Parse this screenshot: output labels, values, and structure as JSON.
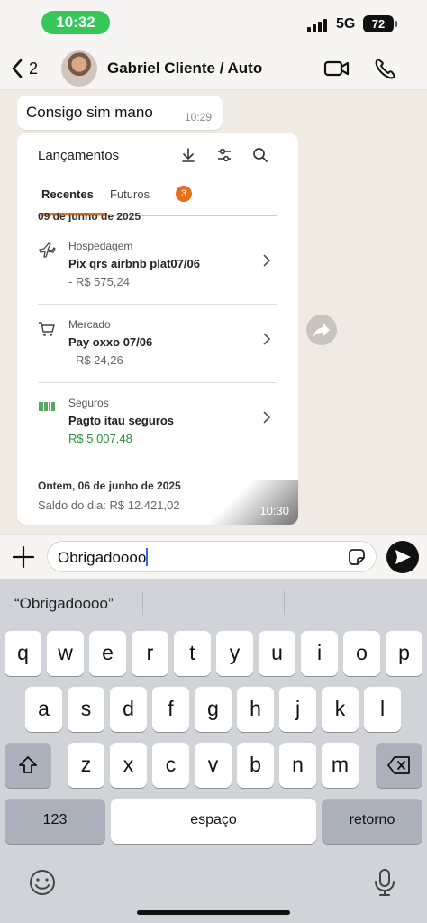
{
  "status_bar": {
    "time": "10:32",
    "network": "5G",
    "battery": "72"
  },
  "header": {
    "back_count": "2",
    "contact_name": "Gabriel Cliente / Auto"
  },
  "messages": [
    {
      "text": "Consigo sim mano",
      "time": "10:29"
    }
  ],
  "image_message": {
    "time": "10:30",
    "screen": {
      "title": "Lançamentos",
      "tabs": [
        {
          "label": "Recentes"
        },
        {
          "label": "Futuros",
          "badge": "3"
        }
      ],
      "date_header": "09 de junho de 2025",
      "transactions": [
        {
          "category": "Hospedagem",
          "description": "Pix qrs airbnb plat07/06",
          "amount": "- R$ 575,24",
          "icon": "airplane-icon"
        },
        {
          "category": "Mercado",
          "description": "Pay oxxo  07/06",
          "amount": "- R$ 24,26",
          "icon": "cart-icon"
        },
        {
          "category": "Seguros",
          "description": "Pagto itau seguros",
          "amount": "R$ 5.007,48",
          "icon": "barcode-icon"
        }
      ],
      "day_title": "Ontem, 06 de junho de 2025",
      "day_balance": "Saldo do dia: R$ 12.421,02"
    }
  },
  "input": {
    "value": "Obrigadoooo"
  },
  "keyboard": {
    "suggestion": "“Obrigadoooo”",
    "row1": [
      "q",
      "w",
      "e",
      "r",
      "t",
      "y",
      "u",
      "i",
      "o",
      "p"
    ],
    "row2": [
      "a",
      "s",
      "d",
      "f",
      "g",
      "h",
      "j",
      "k",
      "l"
    ],
    "row3": [
      "z",
      "x",
      "c",
      "v",
      "b",
      "n",
      "m"
    ],
    "numbers_label": "123",
    "space_label": "espaço",
    "return_label": "retorno"
  },
  "colors": {
    "accent_orange": "#e8701a",
    "positive_green": "#2f8f3e",
    "time_pill": "#35c759"
  }
}
